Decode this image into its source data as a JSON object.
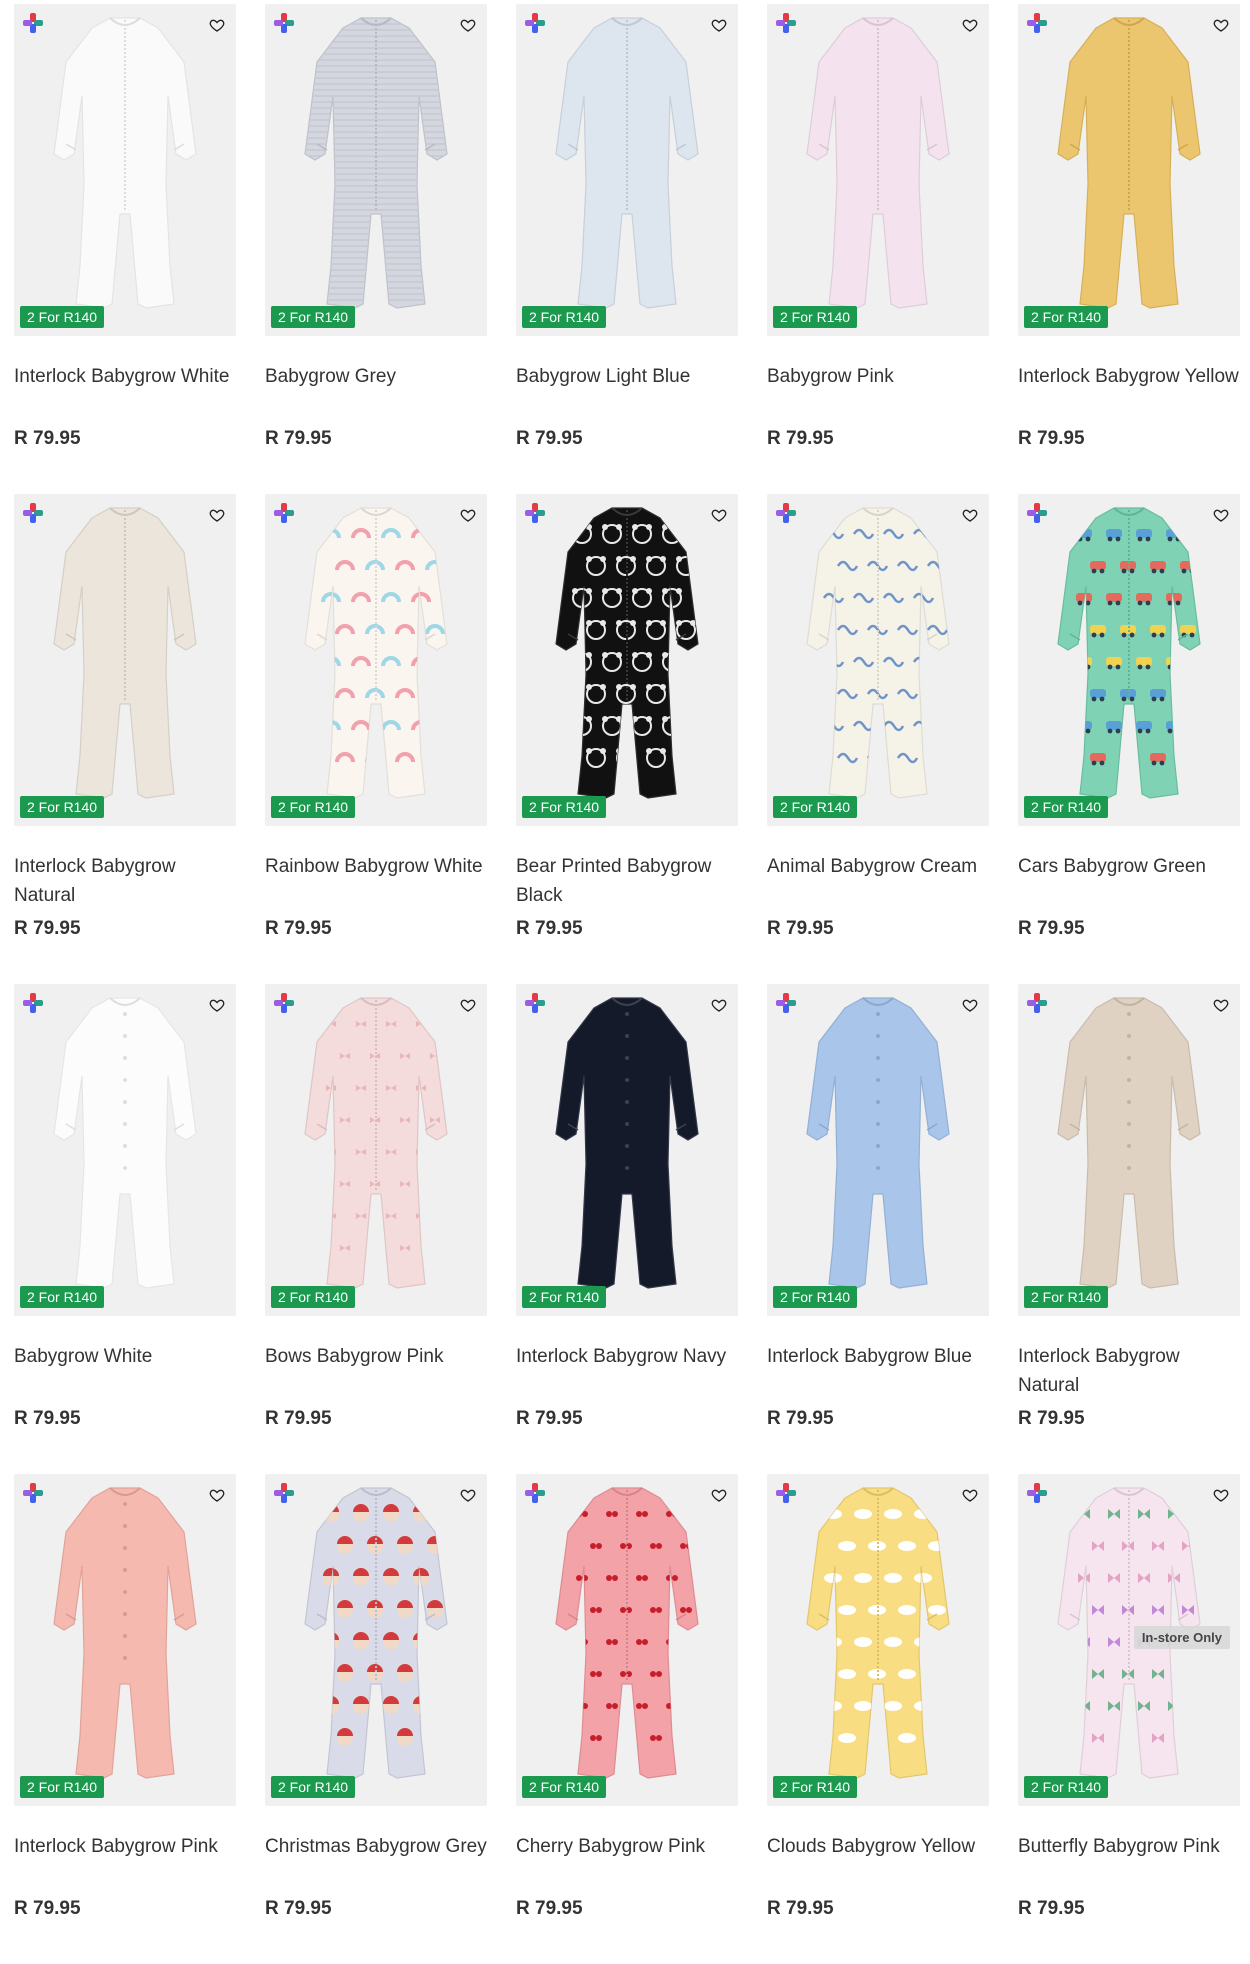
{
  "products": [
    {
      "name": "Interlock Babygrow White",
      "price": "R 79.95",
      "promo": "2 For R140",
      "color": "#fafafa",
      "pattern": "plain",
      "style": "zip"
    },
    {
      "name": "Babygrow Grey",
      "price": "R 79.95",
      "promo": "2 For R140",
      "color": "#d4d7df",
      "pattern": "stripe",
      "style": "zip"
    },
    {
      "name": "Babygrow Light Blue",
      "price": "R 79.95",
      "promo": "2 For R140",
      "color": "#dde6ef",
      "pattern": "plain",
      "style": "zip"
    },
    {
      "name": "Babygrow Pink",
      "price": "R 79.95",
      "promo": "2 For R140",
      "color": "#f4e3ef",
      "pattern": "plain",
      "style": "zip"
    },
    {
      "name": "Interlock Babygrow Yellow",
      "price": "R 79.95",
      "promo": "2 For R140",
      "color": "#ecc66e",
      "pattern": "plain",
      "style": "zip"
    },
    {
      "name": "Interlock Babygrow Natural",
      "price": "R 79.95",
      "promo": "2 For R140",
      "color": "#ebe5dc",
      "pattern": "plain",
      "style": "zip"
    },
    {
      "name": "Rainbow Babygrow White",
      "price": "R 79.95",
      "promo": "2 For R140",
      "color": "#faf5ee",
      "pattern": "rainbow",
      "style": "zip"
    },
    {
      "name": "Bear Printed Babygrow Black",
      "price": "R 79.95",
      "promo": "2 For R140",
      "color": "#111111",
      "pattern": "bear",
      "style": "zip"
    },
    {
      "name": "Animal Babygrow Cream",
      "price": "R 79.95",
      "promo": "2 For R140",
      "color": "#f5f2e8",
      "pattern": "animal",
      "style": "zip"
    },
    {
      "name": "Cars Babygrow Green",
      "price": "R 79.95",
      "promo": "2 For R140",
      "color": "#7fd3b4",
      "pattern": "cars",
      "style": "zip"
    },
    {
      "name": "Babygrow White",
      "price": "R 79.95",
      "promo": "2 For R140",
      "color": "#fcfcfc",
      "pattern": "plain",
      "style": "button"
    },
    {
      "name": "Bows Babygrow Pink",
      "price": "R 79.95",
      "promo": "2 For R140",
      "color": "#f5dcdc",
      "pattern": "bows",
      "style": "zip"
    },
    {
      "name": "Interlock Babygrow Navy",
      "price": "R 79.95",
      "promo": "2 For R140",
      "color": "#141a2a",
      "pattern": "plain",
      "style": "button"
    },
    {
      "name": "Interlock Babygrow Blue",
      "price": "R 79.95",
      "promo": "2 For R140",
      "color": "#a9c6ea",
      "pattern": "plain",
      "style": "button"
    },
    {
      "name": "Interlock Babygrow Natural",
      "price": "R 79.95",
      "promo": "2 For R140",
      "color": "#e0d2c2",
      "pattern": "plain",
      "style": "button"
    },
    {
      "name": "Interlock Babygrow Pink",
      "price": "R 79.95",
      "promo": "2 For R140",
      "color": "#f6b9b0",
      "pattern": "plain",
      "style": "button"
    },
    {
      "name": "Christmas Babygrow Grey",
      "price": "R 79.95",
      "promo": "2 For R140",
      "color": "#d9dce8",
      "pattern": "xmas",
      "style": "zip"
    },
    {
      "name": "Cherry Babygrow Pink",
      "price": "R 79.95",
      "promo": "2 For R140",
      "color": "#f3a3a8",
      "pattern": "cherry",
      "style": "zip"
    },
    {
      "name": "Clouds Babygrow Yellow",
      "price": "R 79.95",
      "promo": "2 For R140",
      "color": "#f8dd82",
      "pattern": "clouds",
      "style": "zip"
    },
    {
      "name": "Butterfly Babygrow Pink",
      "price": "R 79.95",
      "promo": "2 For R140",
      "color": "#f6e4ee",
      "pattern": "butterfly",
      "style": "zip",
      "badge": "In-store Only"
    }
  ],
  "colors": {
    "promo_green": "#1b9a4f",
    "thumb_bg": "#f0f0f0",
    "plus_icon": [
      "#e63946",
      "#2a9d8f",
      "#4361ee",
      "#9b5de5"
    ]
  },
  "icons": {
    "brand": "plus-brand-icon",
    "wishlist": "heart-outline-icon"
  }
}
